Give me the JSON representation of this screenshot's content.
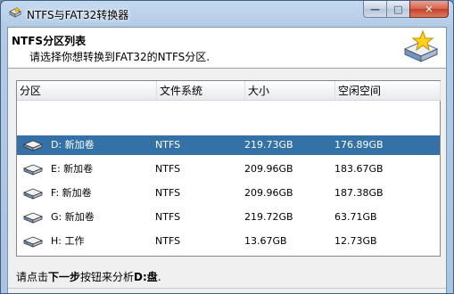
{
  "window": {
    "title": "NTFS与FAT32转换器",
    "icon": "app-disk-icon",
    "controls": {
      "minimize": "—",
      "maximize": "□",
      "close": "✕"
    }
  },
  "header": {
    "title": "NTFS分区列表",
    "subtitle": "请选择你想转换到FAT32的NTFS分区.",
    "icon": "star-disk-wizard-icon"
  },
  "table": {
    "columns": [
      "分区",
      "文件系统",
      "大小",
      "空闲空间"
    ],
    "rows": [
      {
        "partition": "D: 新加卷",
        "fs": "NTFS",
        "size": "219.73GB",
        "free": "176.89GB",
        "selected": true
      },
      {
        "partition": "E: 新加卷",
        "fs": "NTFS",
        "size": "209.96GB",
        "free": "183.67GB",
        "selected": false
      },
      {
        "partition": "F: 新加卷",
        "fs": "NTFS",
        "size": "209.96GB",
        "free": "187.38GB",
        "selected": false
      },
      {
        "partition": "G: 新加卷",
        "fs": "NTFS",
        "size": "219.72GB",
        "free": "63.71GB",
        "selected": false
      },
      {
        "partition": "H: 工作",
        "fs": "NTFS",
        "size": "13.67GB",
        "free": "12.73GB",
        "selected": false
      }
    ]
  },
  "status": {
    "prefix": "请点击",
    "next_label": "下一步",
    "middle": "按钮来分析",
    "drive": "D:盘",
    "suffix": "."
  },
  "colors": {
    "selection": "#3471a6",
    "title_bar": "#b3cbe6"
  }
}
